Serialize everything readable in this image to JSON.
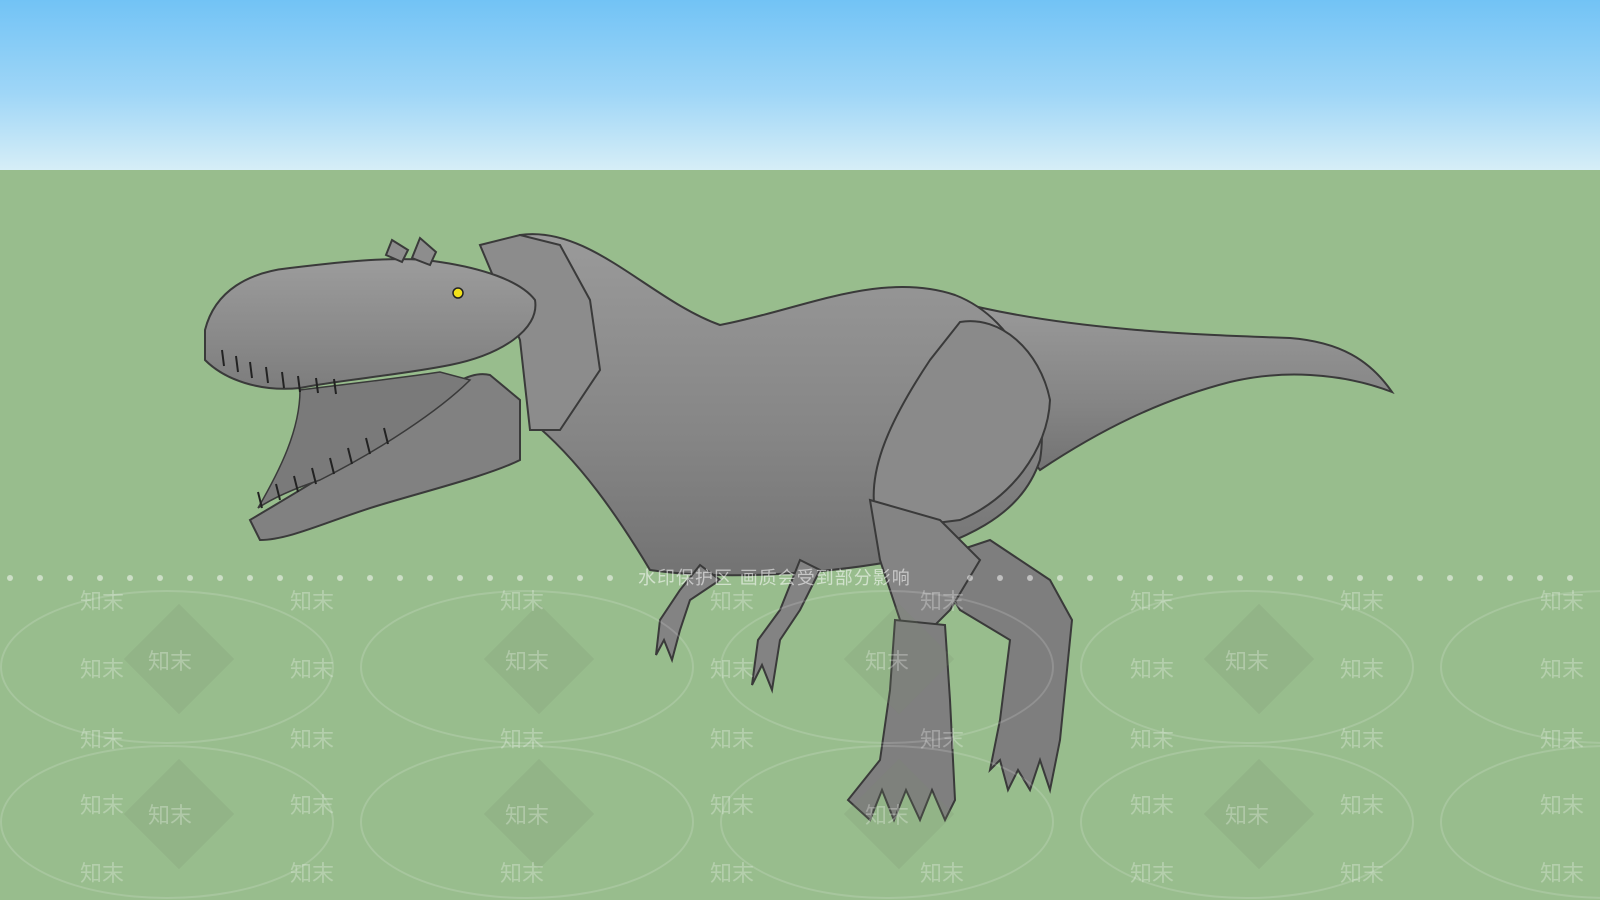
{
  "scene": {
    "sky_color_top": "#72c3f5",
    "sky_color_bottom": "#d6eef7",
    "ground_color": "#98bd8d",
    "model_color": "#8a8a8a",
    "eye_color": "#f2e21a"
  },
  "watermark": {
    "banner_text": "水印保护区  画质会受到部分影响",
    "tile_text": "知末"
  }
}
